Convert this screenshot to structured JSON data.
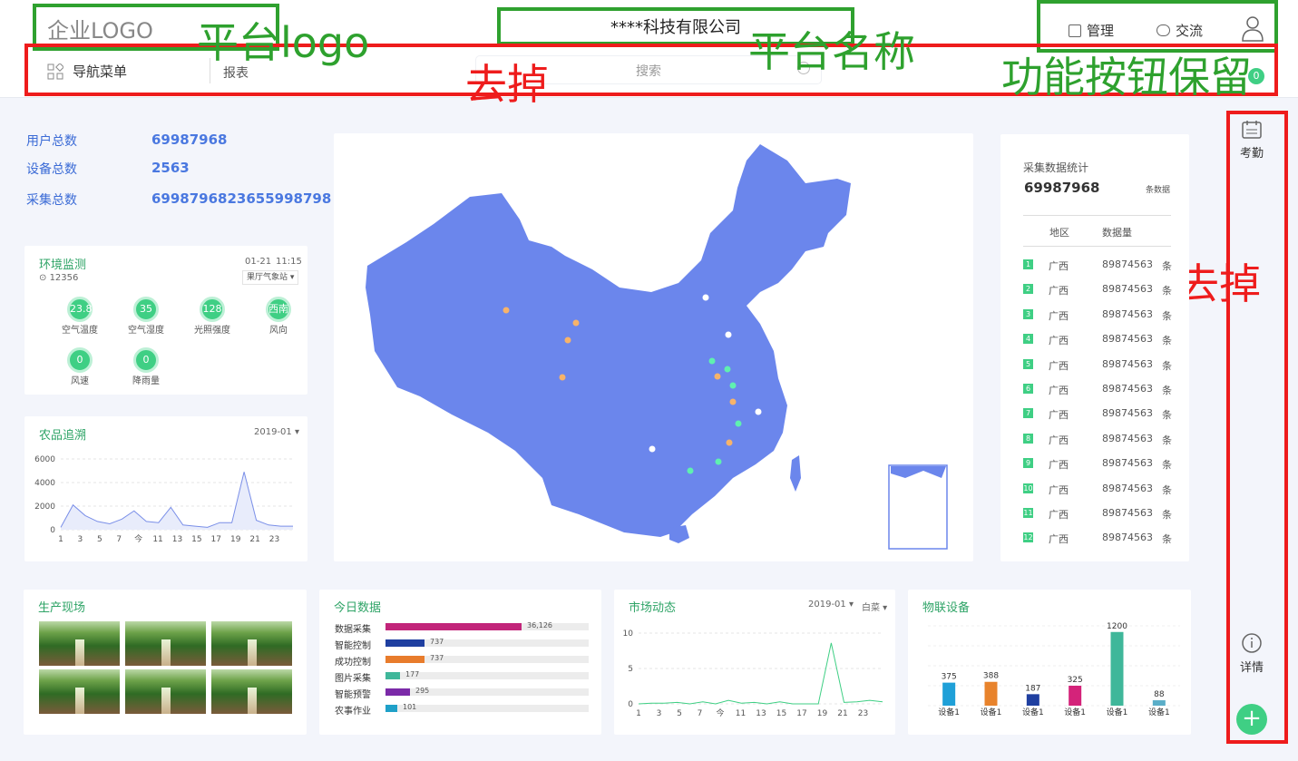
{
  "header": {
    "logo": "企业LOGO",
    "company": "****科技有限公司",
    "manage": "管理",
    "chat": "交流"
  },
  "nav": {
    "menu": "导航菜单",
    "report": "报表",
    "search_placeholder": "搜索",
    "badge": "0"
  },
  "annotations": {
    "logo": "平台logo",
    "name": "平台名称",
    "remove1": "去掉",
    "keep": "功能按钮保留",
    "remove2": "去掉"
  },
  "stats": {
    "users_label": "用户总数",
    "users": "69987968",
    "devices_label": "设备总数",
    "devices": "2563",
    "collect_label": "采集总数",
    "collect": "69987968236559987 98"
  },
  "env": {
    "title": "环境监测",
    "date": "01-21",
    "time": "11:15",
    "loc": "12356",
    "station": "果厅气象站",
    "items": [
      {
        "v": "23.8",
        "l": "空气温度"
      },
      {
        "v": "35",
        "l": "空气湿度"
      },
      {
        "v": "128",
        "l": "光照强度"
      },
      {
        "v": "西南",
        "l": "风向"
      },
      {
        "v": "0",
        "l": "风速"
      },
      {
        "v": "0",
        "l": "降雨量"
      }
    ]
  },
  "trace": {
    "title": "农品追溯",
    "period": "2019-01"
  },
  "collect_stat": {
    "title": "采集数据统计",
    "total": "69987968",
    "unit": "条数据",
    "col_region": "地区",
    "col_amount": "数据量",
    "rows": [
      {
        "i": "1",
        "r": "广西",
        "v": "89874563",
        "u": "条"
      },
      {
        "i": "2",
        "r": "广西",
        "v": "89874563",
        "u": "条"
      },
      {
        "i": "3",
        "r": "广西",
        "v": "89874563",
        "u": "条"
      },
      {
        "i": "4",
        "r": "广西",
        "v": "89874563",
        "u": "条"
      },
      {
        "i": "5",
        "r": "广西",
        "v": "89874563",
        "u": "条"
      },
      {
        "i": "6",
        "r": "广西",
        "v": "89874563",
        "u": "条"
      },
      {
        "i": "7",
        "r": "广西",
        "v": "89874563",
        "u": "条"
      },
      {
        "i": "8",
        "r": "广西",
        "v": "89874563",
        "u": "条"
      },
      {
        "i": "9",
        "r": "广西",
        "v": "89874563",
        "u": "条"
      },
      {
        "i": "10",
        "r": "广西",
        "v": "89874563",
        "u": "条"
      },
      {
        "i": "11",
        "r": "广西",
        "v": "89874563",
        "u": "条"
      },
      {
        "i": "12",
        "r": "广西",
        "v": "89874563",
        "u": "条"
      }
    ]
  },
  "production": {
    "title": "生产现场"
  },
  "today": {
    "title": "今日数据",
    "rows": [
      {
        "l": "数据采集",
        "v": "36,126",
        "p": 0.67,
        "c": "#c2257a"
      },
      {
        "l": "智能控制",
        "v": "737",
        "p": 0.19,
        "c": "#1f3fa0"
      },
      {
        "l": "成功控制",
        "v": "737",
        "p": 0.19,
        "c": "#e87c2c"
      },
      {
        "l": "图片采集",
        "v": "177",
        "p": 0.07,
        "c": "#3fb79a"
      },
      {
        "l": "智能预警",
        "v": "295",
        "p": 0.12,
        "c": "#7b2aa8"
      },
      {
        "l": "农事作业",
        "v": "101",
        "p": 0.06,
        "c": "#1fa0c8"
      }
    ]
  },
  "market": {
    "title": "市场动态",
    "period": "2019-01",
    "item": "白菜"
  },
  "iot": {
    "title": "物联设备"
  },
  "sidebar": {
    "attendance": "考勤",
    "details": "详情"
  },
  "chart_data": [
    {
      "type": "area",
      "title": "农品追溯",
      "x": [
        "1",
        "3",
        "5",
        "7",
        "今",
        "11",
        "13",
        "15",
        "17",
        "19",
        "21",
        "23"
      ],
      "values": [
        200,
        2100,
        1200,
        700,
        500,
        900,
        1600,
        700,
        600,
        1900,
        400,
        300,
        200,
        600,
        600,
        4900,
        800,
        400,
        300,
        300
      ],
      "yticks": [
        "6000",
        "4000",
        "2000",
        "0"
      ],
      "ylim": [
        0,
        6000
      ]
    },
    {
      "type": "line",
      "title": "市场动态",
      "x": [
        "1",
        "3",
        "5",
        "7",
        "今",
        "11",
        "13",
        "15",
        "17",
        "19",
        "21",
        "23"
      ],
      "values": [
        0,
        0.1,
        0.1,
        0.2,
        0,
        0.3,
        0,
        0.5,
        0.1,
        0.2,
        0,
        0.3,
        0,
        0,
        0,
        8.6,
        0.2,
        0.3,
        0.5,
        0.3
      ],
      "yticks": [
        "10",
        "5",
        "0"
      ],
      "ylim": [
        0,
        10
      ]
    },
    {
      "type": "bar",
      "title": "物联设备",
      "categories": [
        "设备1",
        "设备1",
        "设备1",
        "设备1",
        "设备1",
        "设备1"
      ],
      "values": [
        375,
        388,
        187,
        325,
        1200,
        88
      ],
      "colors": [
        "#1fa0d8",
        "#e8832c",
        "#1f3fa0",
        "#d4237a",
        "#3fb79a",
        "#5aaec8"
      ],
      "ylim": [
        0,
        1300
      ]
    }
  ]
}
